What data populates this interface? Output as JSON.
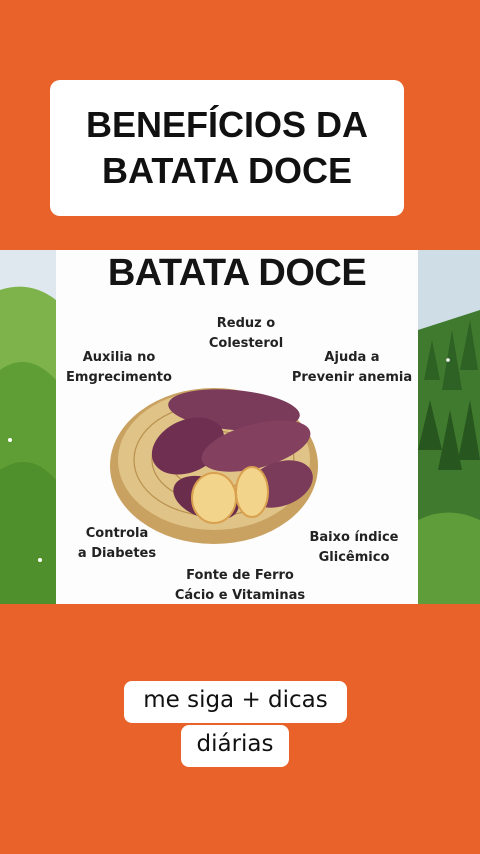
{
  "header": {
    "title_line1": "BENEFÍCIOS DA",
    "title_line2": "BATATA DOCE"
  },
  "infographic": {
    "title": "BATATA DOCE",
    "benefits": {
      "colesterol": [
        "Reduz o",
        "Colesterol"
      ],
      "emagrecimento": [
        "Auxilia no",
        "Emgrecimento"
      ],
      "anemia": [
        "Ajuda a",
        "Prevenir anemia"
      ],
      "diabetes": [
        "Controla",
        "a Diabetes"
      ],
      "glicemico": [
        "Baixo índice",
        "Glicêmico"
      ],
      "ferro": [
        "Fonte de Ferro",
        "Cácio e Vitaminas"
      ]
    }
  },
  "cta": {
    "line1": "me siga + dicas",
    "line2": "diárias"
  },
  "colors": {
    "background": "#e8622a",
    "potato_skin": "#7a3a5a",
    "potato_flesh": "#f2d58a",
    "basket": "#d9b979"
  }
}
